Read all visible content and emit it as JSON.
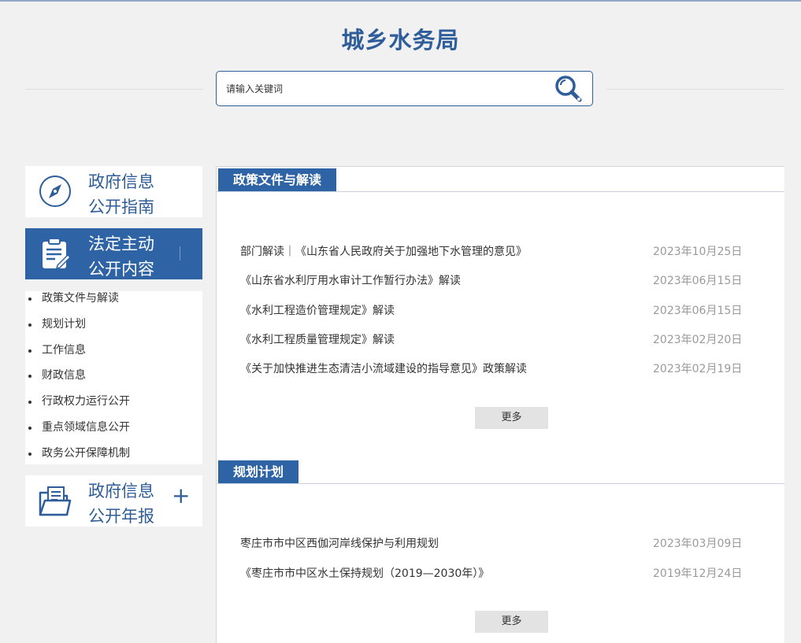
{
  "header": {
    "title": "城乡水务局",
    "search_placeholder": "请输入关键词"
  },
  "sidebar": {
    "cards": [
      {
        "label_line1": "政府信息",
        "label_line2": "公开指南",
        "icon": "compass-icon"
      },
      {
        "label_line1": "法定主动",
        "label_line2": "公开内容",
        "icon": "clipboard-edit-icon",
        "active": true
      },
      {
        "label_line1": "政府信息",
        "label_line2": "公开年报",
        "icon": "folder-document-icon",
        "expand_symbol": "+"
      }
    ],
    "sub_items": [
      "政策文件与解读",
      "规划计划",
      "工作信息",
      "财政信息",
      "行政权力运行公开",
      "重点领域信息公开",
      "政务公开保障机制"
    ]
  },
  "sections": [
    {
      "title": "政策文件与解读",
      "items": [
        {
          "title": "部门解读｜《山东省人民政府关于加强地下水管理的意见》",
          "date": "2023年10月25日"
        },
        {
          "title": "《山东省水利厅用水审计工作暂行办法》解读",
          "date": "2023年06月15日"
        },
        {
          "title": "《水利工程造价管理规定》解读",
          "date": "2023年06月15日"
        },
        {
          "title": "《水利工程质量管理规定》解读",
          "date": "2023年02月20日"
        },
        {
          "title": "《关于加快推进生态清洁小流域建设的指导意见》政策解读",
          "date": "2023年02月19日"
        }
      ],
      "more_label": "更多"
    },
    {
      "title": "规划计划",
      "items": [
        {
          "title": "枣庄市市中区西伽河岸线保护与利用规划",
          "date": "2023年03月09日"
        },
        {
          "title": "《枣庄市市中区水土保持规划（2019—2030年）》",
          "date": "2019年12月24日"
        }
      ],
      "more_label": "更多"
    }
  ],
  "colors": {
    "brand_blue": "#2e64a5",
    "title_blue": "#2e5d9a",
    "date_gray": "#9a9a9a",
    "page_bg": "#f1f1f1"
  }
}
